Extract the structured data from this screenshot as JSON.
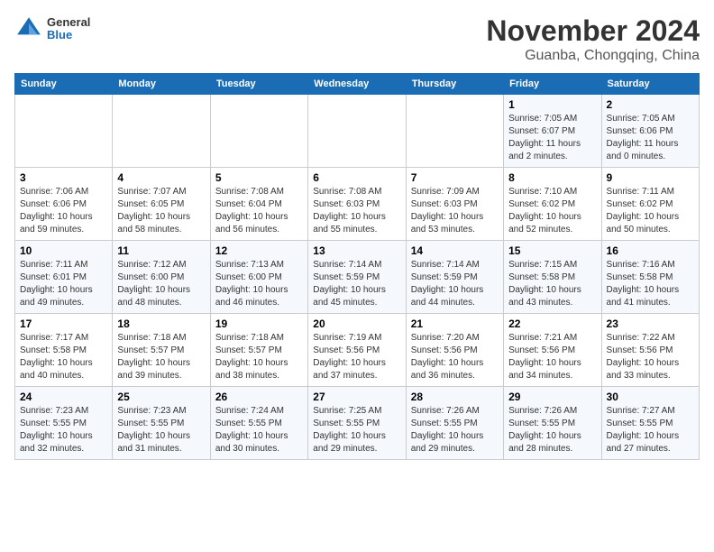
{
  "header": {
    "logo_line1": "General",
    "logo_line2": "Blue",
    "title": "November 2024",
    "subtitle": "Guanba, Chongqing, China"
  },
  "weekdays": [
    "Sunday",
    "Monday",
    "Tuesday",
    "Wednesday",
    "Thursday",
    "Friday",
    "Saturday"
  ],
  "weeks": [
    [
      {
        "day": "",
        "info": ""
      },
      {
        "day": "",
        "info": ""
      },
      {
        "day": "",
        "info": ""
      },
      {
        "day": "",
        "info": ""
      },
      {
        "day": "",
        "info": ""
      },
      {
        "day": "1",
        "info": "Sunrise: 7:05 AM\nSunset: 6:07 PM\nDaylight: 11 hours and 2 minutes."
      },
      {
        "day": "2",
        "info": "Sunrise: 7:05 AM\nSunset: 6:06 PM\nDaylight: 11 hours and 0 minutes."
      }
    ],
    [
      {
        "day": "3",
        "info": "Sunrise: 7:06 AM\nSunset: 6:06 PM\nDaylight: 10 hours and 59 minutes."
      },
      {
        "day": "4",
        "info": "Sunrise: 7:07 AM\nSunset: 6:05 PM\nDaylight: 10 hours and 58 minutes."
      },
      {
        "day": "5",
        "info": "Sunrise: 7:08 AM\nSunset: 6:04 PM\nDaylight: 10 hours and 56 minutes."
      },
      {
        "day": "6",
        "info": "Sunrise: 7:08 AM\nSunset: 6:03 PM\nDaylight: 10 hours and 55 minutes."
      },
      {
        "day": "7",
        "info": "Sunrise: 7:09 AM\nSunset: 6:03 PM\nDaylight: 10 hours and 53 minutes."
      },
      {
        "day": "8",
        "info": "Sunrise: 7:10 AM\nSunset: 6:02 PM\nDaylight: 10 hours and 52 minutes."
      },
      {
        "day": "9",
        "info": "Sunrise: 7:11 AM\nSunset: 6:02 PM\nDaylight: 10 hours and 50 minutes."
      }
    ],
    [
      {
        "day": "10",
        "info": "Sunrise: 7:11 AM\nSunset: 6:01 PM\nDaylight: 10 hours and 49 minutes."
      },
      {
        "day": "11",
        "info": "Sunrise: 7:12 AM\nSunset: 6:00 PM\nDaylight: 10 hours and 48 minutes."
      },
      {
        "day": "12",
        "info": "Sunrise: 7:13 AM\nSunset: 6:00 PM\nDaylight: 10 hours and 46 minutes."
      },
      {
        "day": "13",
        "info": "Sunrise: 7:14 AM\nSunset: 5:59 PM\nDaylight: 10 hours and 45 minutes."
      },
      {
        "day": "14",
        "info": "Sunrise: 7:14 AM\nSunset: 5:59 PM\nDaylight: 10 hours and 44 minutes."
      },
      {
        "day": "15",
        "info": "Sunrise: 7:15 AM\nSunset: 5:58 PM\nDaylight: 10 hours and 43 minutes."
      },
      {
        "day": "16",
        "info": "Sunrise: 7:16 AM\nSunset: 5:58 PM\nDaylight: 10 hours and 41 minutes."
      }
    ],
    [
      {
        "day": "17",
        "info": "Sunrise: 7:17 AM\nSunset: 5:58 PM\nDaylight: 10 hours and 40 minutes."
      },
      {
        "day": "18",
        "info": "Sunrise: 7:18 AM\nSunset: 5:57 PM\nDaylight: 10 hours and 39 minutes."
      },
      {
        "day": "19",
        "info": "Sunrise: 7:18 AM\nSunset: 5:57 PM\nDaylight: 10 hours and 38 minutes."
      },
      {
        "day": "20",
        "info": "Sunrise: 7:19 AM\nSunset: 5:56 PM\nDaylight: 10 hours and 37 minutes."
      },
      {
        "day": "21",
        "info": "Sunrise: 7:20 AM\nSunset: 5:56 PM\nDaylight: 10 hours and 36 minutes."
      },
      {
        "day": "22",
        "info": "Sunrise: 7:21 AM\nSunset: 5:56 PM\nDaylight: 10 hours and 34 minutes."
      },
      {
        "day": "23",
        "info": "Sunrise: 7:22 AM\nSunset: 5:56 PM\nDaylight: 10 hours and 33 minutes."
      }
    ],
    [
      {
        "day": "24",
        "info": "Sunrise: 7:23 AM\nSunset: 5:55 PM\nDaylight: 10 hours and 32 minutes."
      },
      {
        "day": "25",
        "info": "Sunrise: 7:23 AM\nSunset: 5:55 PM\nDaylight: 10 hours and 31 minutes."
      },
      {
        "day": "26",
        "info": "Sunrise: 7:24 AM\nSunset: 5:55 PM\nDaylight: 10 hours and 30 minutes."
      },
      {
        "day": "27",
        "info": "Sunrise: 7:25 AM\nSunset: 5:55 PM\nDaylight: 10 hours and 29 minutes."
      },
      {
        "day": "28",
        "info": "Sunrise: 7:26 AM\nSunset: 5:55 PM\nDaylight: 10 hours and 29 minutes."
      },
      {
        "day": "29",
        "info": "Sunrise: 7:26 AM\nSunset: 5:55 PM\nDaylight: 10 hours and 28 minutes."
      },
      {
        "day": "30",
        "info": "Sunrise: 7:27 AM\nSunset: 5:55 PM\nDaylight: 10 hours and 27 minutes."
      }
    ]
  ]
}
